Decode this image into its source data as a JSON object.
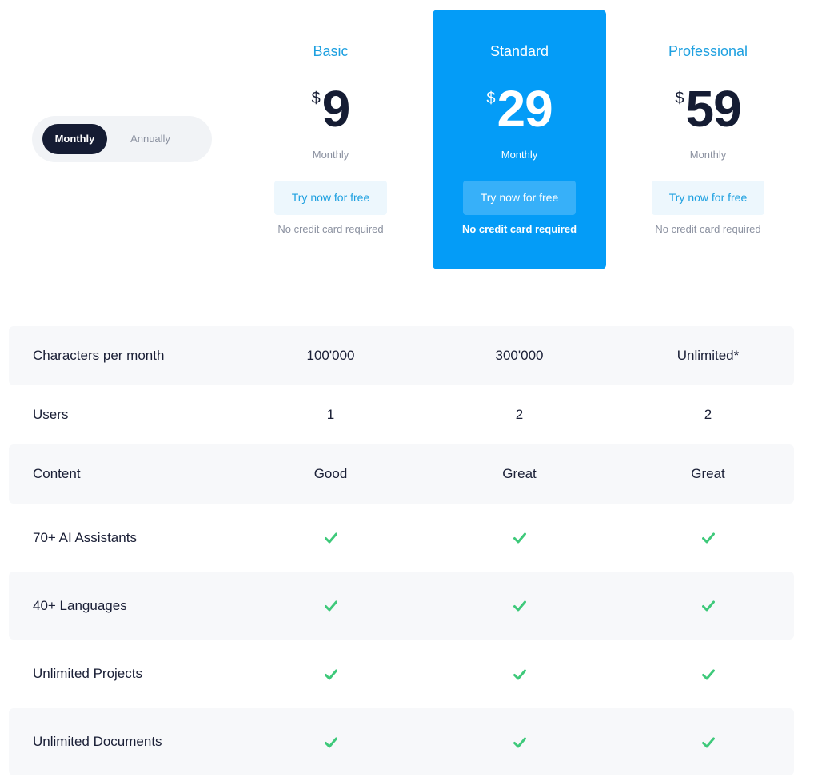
{
  "billing_toggle": {
    "monthly_label": "Monthly",
    "annually_label": "Annually",
    "selected": "Monthly"
  },
  "plans": [
    {
      "name": "Basic",
      "currency": "$",
      "price": "9",
      "period": "Monthly",
      "cta_label": "Try now for free",
      "note": "No credit card required",
      "highlighted": false
    },
    {
      "name": "Standard",
      "currency": "$",
      "price": "29",
      "period": "Monthly",
      "cta_label": "Try now for free",
      "note": "No credit card required",
      "highlighted": true
    },
    {
      "name": "Professional",
      "currency": "$",
      "price": "59",
      "period": "Monthly",
      "cta_label": "Try now for free",
      "note": "No credit card required",
      "highlighted": false
    }
  ],
  "features": [
    {
      "label": "Characters per month",
      "values": [
        "100'000",
        "300'000",
        "Unlimited*"
      ]
    },
    {
      "label": "Users",
      "values": [
        "1",
        "2",
        "2"
      ]
    },
    {
      "label": "Content",
      "values": [
        "Good",
        "Great",
        "Great"
      ]
    },
    {
      "label": "70+ AI Assistants",
      "values": [
        "check-icon",
        "check-icon",
        "check-icon"
      ]
    },
    {
      "label": "40+ Languages",
      "values": [
        "check-icon",
        "check-icon",
        "check-icon"
      ]
    },
    {
      "label": "Unlimited Projects",
      "values": [
        "check-icon",
        "check-icon",
        "check-icon"
      ]
    },
    {
      "label": "Unlimited Documents",
      "values": [
        "check-icon",
        "check-icon",
        "check-icon"
      ]
    }
  ],
  "colors": {
    "accent": "#049cf7",
    "accent_text": "#1ea0e0",
    "dark": "#151c33",
    "check": "#3ec97a",
    "muted": "#8b91a0",
    "row_shade": "#f7f8fa"
  }
}
